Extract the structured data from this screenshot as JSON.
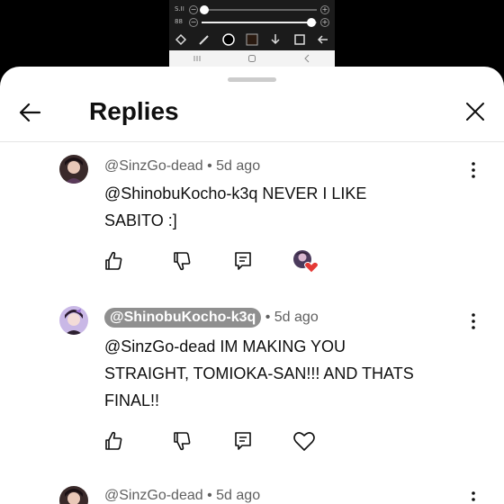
{
  "sheet": {
    "title": "Replies"
  },
  "preview": {
    "slider1_tag": "S.II",
    "slider2_tag": "88",
    "slider1_level": 0.02,
    "slider2_level": 0.95
  },
  "comments": [
    {
      "handle": "@SinzGo-dead",
      "separator": "•",
      "time": "5d ago",
      "text_line1": "@ShinobuKocho-k3q  NEVER I LIKE",
      "text_line2": "SABITO :]",
      "creator_heart": true
    },
    {
      "handle": "@ShinobuKocho-k3q",
      "separator": "•",
      "time": "5d ago",
      "text_line1": "@SinzGo-dead  IM MAKING YOU",
      "text_line2": "STRAIGHT, TOMIOKA-SAN!!! AND THATS",
      "text_line3": "FINAL!!",
      "creator_heart": false
    },
    {
      "handle": "@SinzGo-dead",
      "separator": "•",
      "time": "5d ago"
    }
  ],
  "icons": [
    "back-arrow-icon",
    "close-icon",
    "more-vert-icon",
    "like-icon",
    "dislike-icon",
    "reply-icon",
    "heart-icon"
  ],
  "colors": {
    "text": "#0f0f0f",
    "meta": "#606060",
    "chip": "#8f8f8f",
    "heart": "#e53935"
  }
}
